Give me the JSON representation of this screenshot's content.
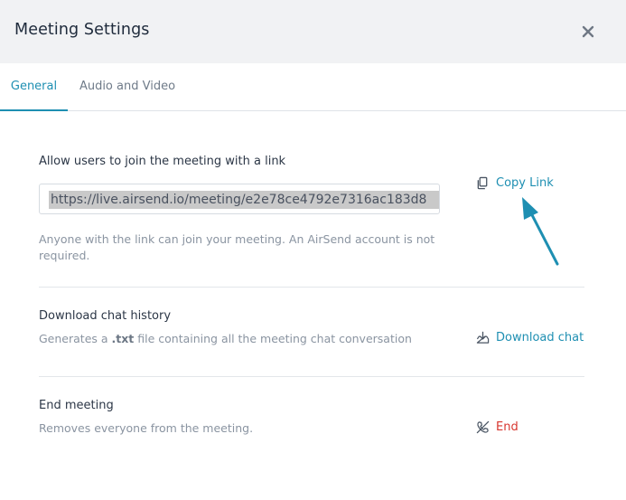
{
  "dialog": {
    "title": "Meeting Settings",
    "close_icon": "close-icon"
  },
  "tabs": [
    {
      "label": "General",
      "active": true
    },
    {
      "label": "Audio and Video",
      "active": false
    }
  ],
  "link_section": {
    "label": "Allow users to join the meeting with a link",
    "url": "https://live.airsend.io/meeting/e2e78ce4792e7316ac183d8",
    "copy_label": "Copy Link",
    "description": "Anyone with the link can join your meeting. An AirSend account is not required."
  },
  "chat_section": {
    "label": "Download chat history",
    "desc_prefix": "Generates a ",
    "desc_ext": ".txt",
    "desc_suffix": " file containing all the meeting chat conversation",
    "action_label": "Download chat"
  },
  "end_section": {
    "label": "End meeting",
    "description": "Removes everyone from the meeting.",
    "action_label": "End"
  },
  "colors": {
    "accent": "#1e8fb2",
    "danger": "#d8362f",
    "header_bg": "#f1f2f4"
  }
}
